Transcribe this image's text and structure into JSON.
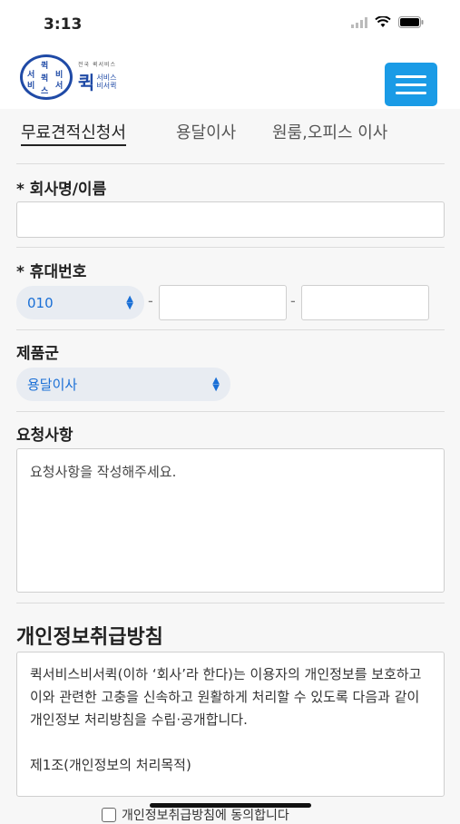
{
  "status_bar": {
    "time": "3:13"
  },
  "logo": {
    "circle_chars": [
      "퀵",
      "서",
      "비",
      "스",
      "비",
      "서",
      "퀵"
    ],
    "sub": "전국 퀵서비스",
    "main": "퀵",
    "line1": "서비스",
    "line2": "비서퀵"
  },
  "tabs": [
    "무료견적신청서",
    "용달이사",
    "원룸,오피스 이사"
  ],
  "form": {
    "company_label": "* 회사명/이름",
    "company_value": "",
    "phone_label": "* 휴대번호",
    "phone_prefix": "010",
    "phone_sep": "-",
    "product_label": "제품군",
    "product_value": "용달이사",
    "request_label": "요청사항",
    "request_placeholder": "요청사항을 작성해주세요."
  },
  "privacy": {
    "title": "개인정보취급방침",
    "body": "퀵서비스비서퀵(이하 ‘회사’라 한다)는 이용자의 개인정보를 보호하고 이와 관련한 고충을 신속하고 원활하게 처리할 수 있도록 다음과 같이 개인정보 처리방침을 수립·공개합니다.",
    "article1": "제1조(개인정보의 처리목적)",
    "agree_label": "개인정보취급방침에 동의합니다"
  }
}
